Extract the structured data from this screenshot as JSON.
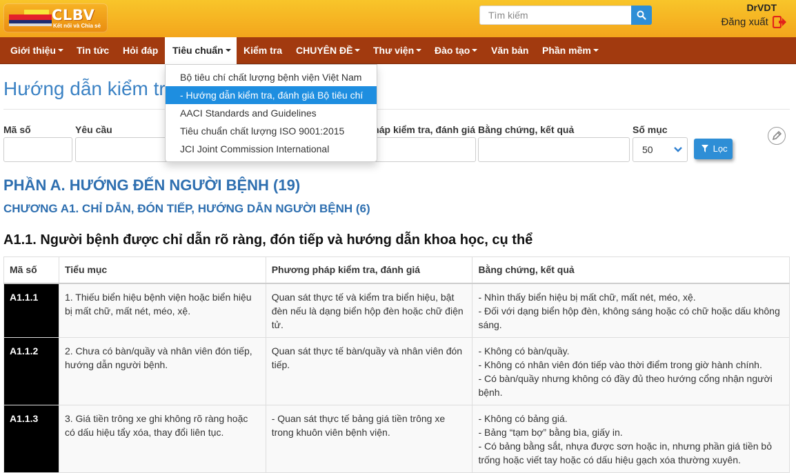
{
  "header": {
    "logo": {
      "brand": "CLBV",
      "tagline": "Kết nối và Chia sẻ"
    },
    "search": {
      "placeholder": "Tìm kiếm"
    },
    "user": {
      "name": "DrVDT",
      "logout_label": "Đăng xuất"
    }
  },
  "nav": {
    "items": [
      {
        "label": "Giới thiệu",
        "has_caret": true
      },
      {
        "label": "Tin tức",
        "has_caret": false
      },
      {
        "label": "Hỏi đáp",
        "has_caret": false
      },
      {
        "label": "Tiêu chuẩn",
        "has_caret": true,
        "active": true
      },
      {
        "label": "Kiểm tra",
        "has_caret": false
      },
      {
        "label": "CHUYÊN ĐỀ",
        "has_caret": true
      },
      {
        "label": "Thư viện",
        "has_caret": true
      },
      {
        "label": "Đào tạo",
        "has_caret": true
      },
      {
        "label": "Văn bản",
        "has_caret": false
      },
      {
        "label": "Phần mềm",
        "has_caret": true
      }
    ],
    "dropdown": [
      {
        "label": "Bộ tiêu chí chất lượng bệnh viện Việt Nam"
      },
      {
        "label": "- Hướng dẫn kiểm tra, đánh giá Bộ tiêu chí",
        "selected": true
      },
      {
        "label": "AACI Standards and Guidelines"
      },
      {
        "label": "Tiêu chuẩn chất lượng ISO 9001:2015"
      },
      {
        "label": "JCI Joint Commission International"
      }
    ]
  },
  "page": {
    "title": "Hướng dẫn kiểm tra, đánh giá Bộ tiêu chí"
  },
  "filters": {
    "labels": [
      "Mã số",
      "Yêu cầu",
      "Phương pháp kiểm tra, đánh giá",
      "Bằng chứng, kết quả",
      "Số mục"
    ],
    "page_size_value": "50",
    "filter_button": "Lọc"
  },
  "content": {
    "part": "PHẦN A. HƯỚNG ĐẾN NGƯỜI BỆNH (19)",
    "chapter": "CHƯƠNG A1. CHỈ DẪN, ĐÓN TIẾP, HƯỚNG DẪN NGƯỜI BỆNH (6)",
    "section": "A1.1. Người bệnh được chỉ dẫn rõ ràng, đón tiếp và hướng dẫn khoa học, cụ thể",
    "table": {
      "headers": [
        "Mã số",
        "Tiểu mục",
        "Phương pháp kiểm tra, đánh giá",
        "Bằng chứng, kết quả"
      ],
      "rows": [
        {
          "code": "A1.1.1",
          "item": [
            "1. Thiếu biển hiệu bệnh viện hoặc biển hiệu",
            "bị mất chữ, mất nét, méo, xệ."
          ],
          "method": [
            "Quan sát thực tế và kiểm tra biển hiệu, bật",
            "đèn nếu là dạng biển hộp đèn hoặc chữ điện",
            "tử."
          ],
          "evidence": [
            "- Nhìn thấy biển hiệu bị mất chữ, mất nét, méo, xệ.",
            "- Đối với dạng biển hộp đèn, không sáng hoặc có chữ hoặc dấu không",
            "sáng."
          ]
        },
        {
          "code": "A1.1.2",
          "item": [
            "2. Chưa có bàn/quầy và nhân viên đón tiếp,",
            "hướng dẫn người bệnh."
          ],
          "method": [
            "Quan sát thực tế bàn/quầy và nhân viên đón",
            "tiếp."
          ],
          "evidence": [
            "- Không có bàn/quầy.",
            "- Không có nhân viên đón tiếp vào thời điểm trong giờ hành chính.",
            "- Có bàn/quầy nhưng không có đầy đủ theo hướng cổng nhận người",
            "bệnh."
          ]
        },
        {
          "code": "A1.1.3",
          "item": [
            "3. Giá tiền trông xe ghi không rõ ràng hoặc",
            "có dấu hiệu tẩy xóa, thay đổi liên tục."
          ],
          "method": [
            "- Quan sát thực tế bảng giá tiền trông xe",
            "trong khuôn viên bệnh viện."
          ],
          "evidence": [
            "- Không có bảng giá.",
            "- Bảng “tạm bợ” bằng bìa, giấy in.",
            "- Có bảng bằng sắt, nhựa được sơn hoặc in, nhưng phần giá tiền bỏ",
            "trống hoặc viết tay hoặc có dấu hiệu gạch xóa thường xuyên."
          ]
        }
      ]
    }
  }
}
